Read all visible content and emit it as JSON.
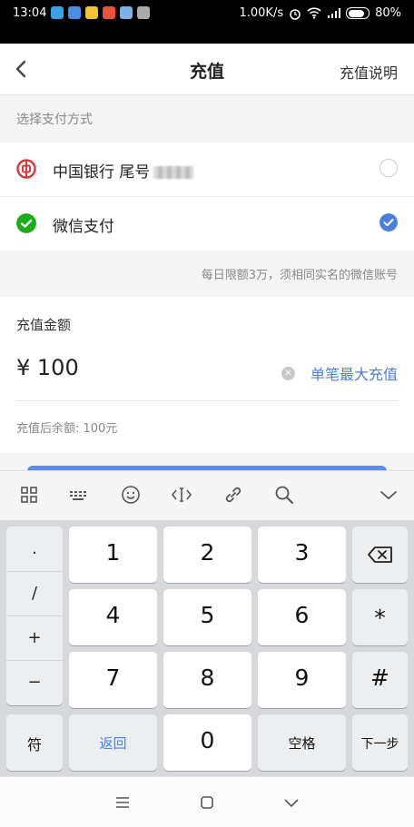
{
  "status_bar": {
    "time": "13:04",
    "speed": "1.00K/s",
    "battery": "80%"
  },
  "header": {
    "back_icon": "chevron-left-icon",
    "title": "充值",
    "help_link": "充值说明"
  },
  "payment": {
    "section_label": "选择支付方式",
    "options": [
      {
        "icon": "bank-of-china-icon",
        "label": "中国银行  尾号",
        "selected": false,
        "icon_color": "#d9363e"
      },
      {
        "icon": "wechat-icon",
        "label": "微信支付",
        "selected": true,
        "icon_color": "#1aad19"
      }
    ],
    "limit_note": "每日限额3万，须相同实名的微信账号"
  },
  "amount": {
    "label": "充值金额",
    "value": "¥ 100",
    "max_link": "单笔最大充值",
    "balance_after": "充值后余额: 100元"
  },
  "keyboard": {
    "toolbar_icons": [
      "grid-icon",
      "keyboard-icon",
      "emoji-icon",
      "cursor-move-icon",
      "link-icon",
      "search-icon",
      "collapse-keyboard-icon"
    ],
    "symbols": [
      ".",
      "/",
      "+",
      "−"
    ],
    "digits": [
      "1",
      "2",
      "3",
      "4",
      "5",
      "6",
      "7",
      "8",
      "9",
      "0"
    ],
    "right_col": [
      "⌫",
      "*",
      "#"
    ],
    "bottom": {
      "symbol_key": "符",
      "back_key": "返回",
      "space_key": "空格",
      "next_key": "下一步"
    }
  },
  "colors": {
    "accent": "#4a7fdc",
    "wechat_green": "#1aad19",
    "boc_red": "#d9363e"
  },
  "nav_icons": [
    "menu-icon",
    "home-icon",
    "back-icon"
  ]
}
